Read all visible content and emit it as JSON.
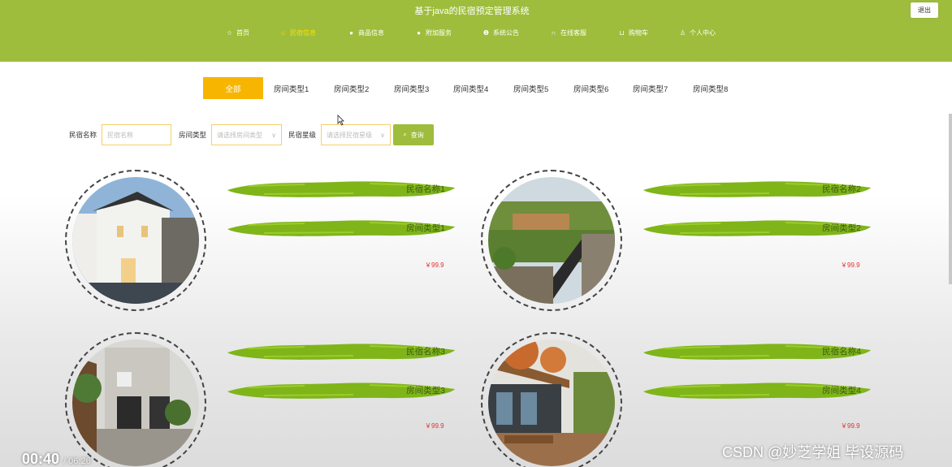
{
  "header": {
    "title": "基于java的民宿预定管理系统",
    "logout_label": "退出",
    "nav": [
      {
        "label": "首页",
        "icon": "star-icon"
      },
      {
        "label": "民宿信息",
        "icon": "home-icon",
        "active": true
      },
      {
        "label": "商品信息",
        "icon": "dot-icon"
      },
      {
        "label": "附加服务",
        "icon": "dot-icon"
      },
      {
        "label": "系统公告",
        "icon": "info-icon"
      },
      {
        "label": "在线客服",
        "icon": "headset-icon"
      },
      {
        "label": "购物车",
        "icon": "cart-icon"
      },
      {
        "label": "个人中心",
        "icon": "user-icon"
      }
    ]
  },
  "tabs": [
    "全部",
    "房间类型1",
    "房间类型2",
    "房间类型3",
    "房间类型4",
    "房间类型5",
    "房间类型6",
    "房间类型7",
    "房间类型8"
  ],
  "search": {
    "name_label": "民宿名称",
    "name_placeholder": "民宿名称",
    "type_label": "房间类型",
    "type_placeholder": "请选择房间类型",
    "star_label": "民宿星级",
    "star_placeholder": "请选择民宿星级",
    "button_label": "查询"
  },
  "cards": [
    {
      "name": "民宿名称1",
      "type": "房间类型1",
      "price": "￥99.9"
    },
    {
      "name": "民宿名称2",
      "type": "房间类型2",
      "price": "￥99.9"
    },
    {
      "name": "民宿名称3",
      "type": "房间类型3",
      "price": "￥99.9"
    },
    {
      "name": "民宿名称4",
      "type": "房间类型4",
      "price": "￥99.9"
    }
  ],
  "video": {
    "current": "00:40",
    "total": "/ 06:26"
  },
  "watermark": "CSDN @妙芝学姐 毕设源码",
  "colors": {
    "header_green": "#9ebd3c",
    "accent_yellow": "#f7b500",
    "price_red": "#e03030"
  }
}
